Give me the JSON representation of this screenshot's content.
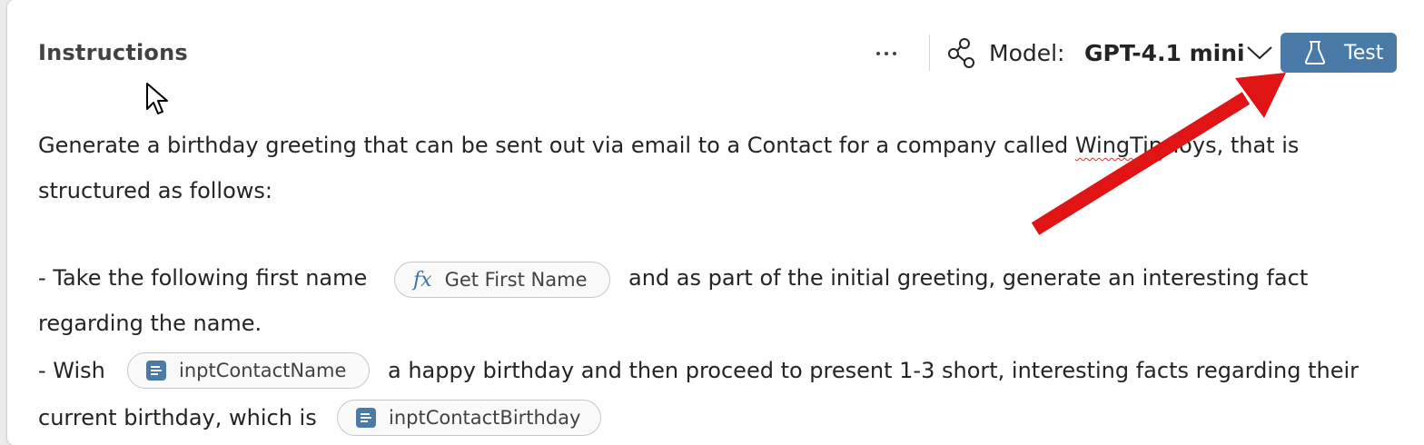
{
  "header": {
    "title": "Instructions",
    "model_label": "Model:",
    "model_value": "GPT-4.1 mini",
    "test_label": "Test"
  },
  "instructions": {
    "line1_a": "Generate a birthday greeting that can be sent out via email to a Contact for a company called ",
    "line1_b": "WingTip",
    "line1_c": " Toys, that is",
    "line2": "structured as follows:",
    "line3_a": "- Take the following first name",
    "chip_first_name": "Get First Name",
    "line3_b": "and as part of the initial greeting, generate an interesting fact",
    "line4": "regarding the name.",
    "line5_a": "- Wish",
    "chip_contact_name": "inptContactName",
    "line5_b": "a happy birthday and then proceed to present 1-3 short, interesting facts regarding their",
    "line6_a": "current birthday, which is",
    "chip_contact_birthday": "inptContactBirthday"
  },
  "icons": {
    "more": "more-horizontal-icon",
    "model": "model-nodes-icon",
    "chevron": "chevron-down-icon",
    "test": "flask-icon",
    "formula": "fx-icon",
    "variable": "variable-icon"
  },
  "colors": {
    "accent": "#4a7aa8",
    "annotation_arrow": "#e01414",
    "spelling_underline": "#d13438"
  }
}
